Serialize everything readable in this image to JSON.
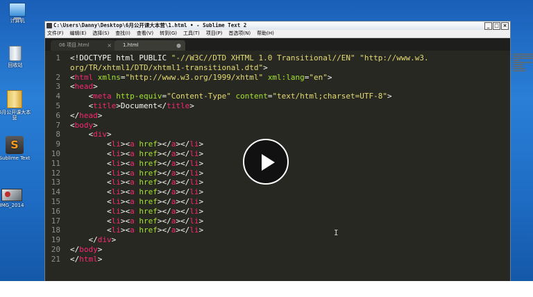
{
  "desktop": {
    "icons": [
      {
        "label": "计算机",
        "icon": "computer-icon"
      },
      {
        "label": "回收站",
        "icon": "recycle-bin-icon"
      },
      {
        "label": "6月公开课大本营",
        "icon": "folder-icon"
      },
      {
        "label": "Sublime Text",
        "icon": "sublime-icon",
        "glyph": "S"
      },
      {
        "label": "IMG_2014",
        "icon": "image-icon"
      }
    ]
  },
  "window": {
    "title": "C:\\Users\\Danny\\Desktop\\6月公开课大本营\\1.html • - Sublime Text 2",
    "buttons": {
      "minimize": "_",
      "maximize": "□",
      "close": "×"
    }
  },
  "menu": [
    "文件(F)",
    "编辑(E)",
    "选择(S)",
    "查找(I)",
    "查看(V)",
    "转到(G)",
    "工具(T)",
    "项目(P)",
    "首选项(N)",
    "帮助(H)"
  ],
  "tabs": [
    {
      "label": "06 项目.html",
      "close": "×",
      "active": false
    },
    {
      "label": "1.html",
      "close": "●",
      "active": true
    }
  ],
  "code_lines": [
    {
      "n": "1",
      "segs": [
        [
          "t",
          "<!DOCTYPE html PUBLIC "
        ],
        [
          "s",
          "\"-//W3C//DTD XHTML 1.0 Transitional//EN\""
        ],
        [
          "t",
          " "
        ],
        [
          "s",
          "\"http://www.w3."
        ]
      ]
    },
    {
      "n": "",
      "segs": [
        [
          "s",
          "org/TR/xhtml1/DTD/xhtml1-transitional.dtd\""
        ],
        [
          "t",
          ">"
        ]
      ]
    },
    {
      "n": "2",
      "segs": [
        [
          "t",
          "<"
        ],
        [
          "g",
          "html"
        ],
        [
          "t",
          " "
        ],
        [
          "a",
          "xmlns"
        ],
        [
          "t",
          "="
        ],
        [
          "s",
          "\"http://www.w3.org/1999/xhtml\""
        ],
        [
          "t",
          " "
        ],
        [
          "a",
          "xml:lang"
        ],
        [
          "t",
          "="
        ],
        [
          "s",
          "\"en\""
        ],
        [
          "t",
          ">"
        ]
      ]
    },
    {
      "n": "3",
      "segs": [
        [
          "t",
          "<"
        ],
        [
          "g",
          "head"
        ],
        [
          "t",
          ">"
        ]
      ]
    },
    {
      "n": "4",
      "segs": [
        [
          "t",
          "    <"
        ],
        [
          "g",
          "meta"
        ],
        [
          "t",
          " "
        ],
        [
          "a",
          "http-equiv"
        ],
        [
          "t",
          "="
        ],
        [
          "s",
          "\"Content-Type\""
        ],
        [
          "t",
          " "
        ],
        [
          "a",
          "content"
        ],
        [
          "t",
          "="
        ],
        [
          "s",
          "\"text/html;charset=UTF-8\""
        ],
        [
          "t",
          ">"
        ]
      ]
    },
    {
      "n": "5",
      "segs": [
        [
          "t",
          "    <"
        ],
        [
          "g",
          "title"
        ],
        [
          "t",
          ">Document</"
        ],
        [
          "g",
          "title"
        ],
        [
          "t",
          ">"
        ]
      ]
    },
    {
      "n": "6",
      "segs": [
        [
          "t",
          "</"
        ],
        [
          "g",
          "head"
        ],
        [
          "t",
          ">"
        ]
      ]
    },
    {
      "n": "7",
      "segs": [
        [
          "t",
          "<"
        ],
        [
          "g",
          "body"
        ],
        [
          "t",
          ">"
        ]
      ]
    },
    {
      "n": "8",
      "segs": [
        [
          "t",
          "    <"
        ],
        [
          "g",
          "div"
        ],
        [
          "t",
          ">"
        ]
      ]
    },
    {
      "n": "9",
      "segs": [
        [
          "t",
          "        <"
        ],
        [
          "g",
          "li"
        ],
        [
          "t",
          "><"
        ],
        [
          "g",
          "a"
        ],
        [
          "t",
          " "
        ],
        [
          "a",
          "href"
        ],
        [
          "t",
          "></"
        ],
        [
          "g",
          "a"
        ],
        [
          "t",
          "></"
        ],
        [
          "g",
          "li"
        ],
        [
          "t",
          ">"
        ]
      ]
    },
    {
      "n": "10",
      "segs": [
        [
          "t",
          "        <"
        ],
        [
          "g",
          "li"
        ],
        [
          "t",
          "><"
        ],
        [
          "g",
          "a"
        ],
        [
          "t",
          " "
        ],
        [
          "a",
          "href"
        ],
        [
          "t",
          "></"
        ],
        [
          "g",
          "a"
        ],
        [
          "t",
          "></"
        ],
        [
          "g",
          "li"
        ],
        [
          "t",
          ">"
        ]
      ]
    },
    {
      "n": "11",
      "segs": [
        [
          "t",
          "        <"
        ],
        [
          "g",
          "li"
        ],
        [
          "t",
          "><"
        ],
        [
          "g",
          "a"
        ],
        [
          "t",
          " "
        ],
        [
          "a",
          "href"
        ],
        [
          "t",
          "></"
        ],
        [
          "g",
          "a"
        ],
        [
          "t",
          "></"
        ],
        [
          "g",
          "li"
        ],
        [
          "t",
          ">"
        ]
      ]
    },
    {
      "n": "12",
      "segs": [
        [
          "t",
          "        <"
        ],
        [
          "g",
          "li"
        ],
        [
          "t",
          "><"
        ],
        [
          "g",
          "a"
        ],
        [
          "t",
          " "
        ],
        [
          "a",
          "href"
        ],
        [
          "t",
          "></"
        ],
        [
          "g",
          "a"
        ],
        [
          "t",
          "></"
        ],
        [
          "g",
          "li"
        ],
        [
          "t",
          ">"
        ]
      ]
    },
    {
      "n": "13",
      "segs": [
        [
          "t",
          "        <"
        ],
        [
          "g",
          "li"
        ],
        [
          "t",
          "><"
        ],
        [
          "g",
          "a"
        ],
        [
          "t",
          " "
        ],
        [
          "a",
          "href"
        ],
        [
          "t",
          "></"
        ],
        [
          "g",
          "a"
        ],
        [
          "t",
          "></"
        ],
        [
          "g",
          "li"
        ],
        [
          "t",
          ">"
        ]
      ]
    },
    {
      "n": "14",
      "segs": [
        [
          "t",
          "        <"
        ],
        [
          "g",
          "li"
        ],
        [
          "t",
          "><"
        ],
        [
          "g",
          "a"
        ],
        [
          "t",
          " "
        ],
        [
          "a",
          "href"
        ],
        [
          "t",
          "></"
        ],
        [
          "g",
          "a"
        ],
        [
          "t",
          "></"
        ],
        [
          "g",
          "li"
        ],
        [
          "t",
          ">"
        ]
      ]
    },
    {
      "n": "15",
      "segs": [
        [
          "t",
          "        <"
        ],
        [
          "g",
          "li"
        ],
        [
          "t",
          "><"
        ],
        [
          "g",
          "a"
        ],
        [
          "t",
          " "
        ],
        [
          "a",
          "href"
        ],
        [
          "t",
          "></"
        ],
        [
          "g",
          "a"
        ],
        [
          "t",
          "></"
        ],
        [
          "g",
          "li"
        ],
        [
          "t",
          ">"
        ]
      ]
    },
    {
      "n": "16",
      "segs": [
        [
          "t",
          "        <"
        ],
        [
          "g",
          "li"
        ],
        [
          "t",
          "><"
        ],
        [
          "g",
          "a"
        ],
        [
          "t",
          " "
        ],
        [
          "a",
          "href"
        ],
        [
          "t",
          "></"
        ],
        [
          "g",
          "a"
        ],
        [
          "t",
          "></"
        ],
        [
          "g",
          "li"
        ],
        [
          "t",
          ">"
        ]
      ]
    },
    {
      "n": "17",
      "segs": [
        [
          "t",
          "        <"
        ],
        [
          "g",
          "li"
        ],
        [
          "t",
          "><"
        ],
        [
          "g",
          "a"
        ],
        [
          "t",
          " "
        ],
        [
          "a",
          "href"
        ],
        [
          "t",
          "></"
        ],
        [
          "g",
          "a"
        ],
        [
          "t",
          "></"
        ],
        [
          "g",
          "li"
        ],
        [
          "t",
          ">"
        ]
      ]
    },
    {
      "n": "18",
      "segs": [
        [
          "t",
          "        <"
        ],
        [
          "g",
          "li"
        ],
        [
          "t",
          "><"
        ],
        [
          "g",
          "a"
        ],
        [
          "t",
          " "
        ],
        [
          "a",
          "href"
        ],
        [
          "t",
          "></"
        ],
        [
          "g",
          "a"
        ],
        [
          "t",
          "></"
        ],
        [
          "g",
          "li"
        ],
        [
          "t",
          ">"
        ]
      ]
    },
    {
      "n": "19",
      "segs": [
        [
          "t",
          "    </"
        ],
        [
          "g",
          "div"
        ],
        [
          "t",
          ">"
        ]
      ]
    },
    {
      "n": "20",
      "segs": [
        [
          "t",
          "</"
        ],
        [
          "g",
          "body"
        ],
        [
          "t",
          ">"
        ]
      ]
    },
    {
      "n": "21",
      "segs": [
        [
          "t",
          "</"
        ],
        [
          "g",
          "html"
        ],
        [
          "t",
          ">"
        ]
      ]
    }
  ],
  "player": {
    "icon": "play-icon"
  },
  "colors": {
    "editor_bg": "#272822",
    "tag": "#f92672",
    "attr": "#a6e22e",
    "string": "#e6db74",
    "text": "#f8f8f2",
    "line_number": "#8f908a"
  }
}
